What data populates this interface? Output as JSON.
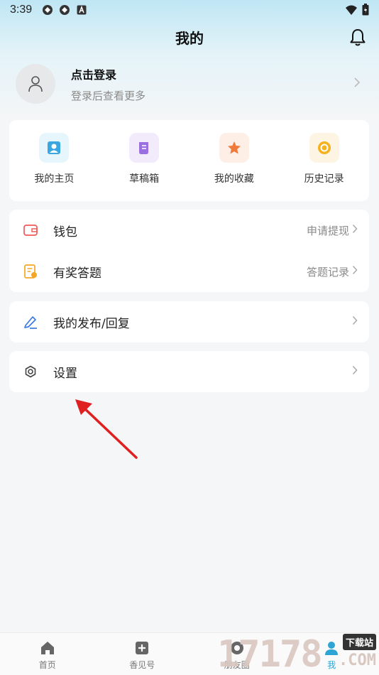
{
  "status_bar": {
    "time": "3:39"
  },
  "header": {
    "title": "我的"
  },
  "profile": {
    "title": "点击登录",
    "subtitle": "登录后查看更多"
  },
  "quick_actions": [
    {
      "label": "我的主页",
      "icon": "user-icon",
      "color": "#3aa7e0",
      "bg": "#e7f5fc"
    },
    {
      "label": "草稿箱",
      "icon": "scroll-icon",
      "color": "#9b6fe0",
      "bg": "#f1ebfb"
    },
    {
      "label": "我的收藏",
      "icon": "star-icon",
      "color": "#f07a3a",
      "bg": "#fdeee6"
    },
    {
      "label": "历史记录",
      "icon": "clock-icon",
      "color": "#f5b21e",
      "bg": "#fdf4e3"
    }
  ],
  "menu": {
    "wallet": {
      "label": "钱包",
      "right": "申请提现"
    },
    "quiz": {
      "label": "有奖答题",
      "right": "答题记录"
    },
    "publish": {
      "label": "我的发布/回复"
    },
    "settings": {
      "label": "设置"
    }
  },
  "tabbar": [
    {
      "label": "首页",
      "icon": "home-icon"
    },
    {
      "label": "香见号",
      "icon": "plus-square-icon"
    },
    {
      "label": "朋友圈",
      "icon": "circle-icon"
    },
    {
      "label": "我",
      "icon": "person-icon",
      "active": true
    }
  ],
  "watermark": {
    "digits": "17178",
    "top": "下载站",
    "bottom": ".COM"
  },
  "colors": {
    "accent": "#2ea5d4",
    "arrow": "#e02020"
  }
}
